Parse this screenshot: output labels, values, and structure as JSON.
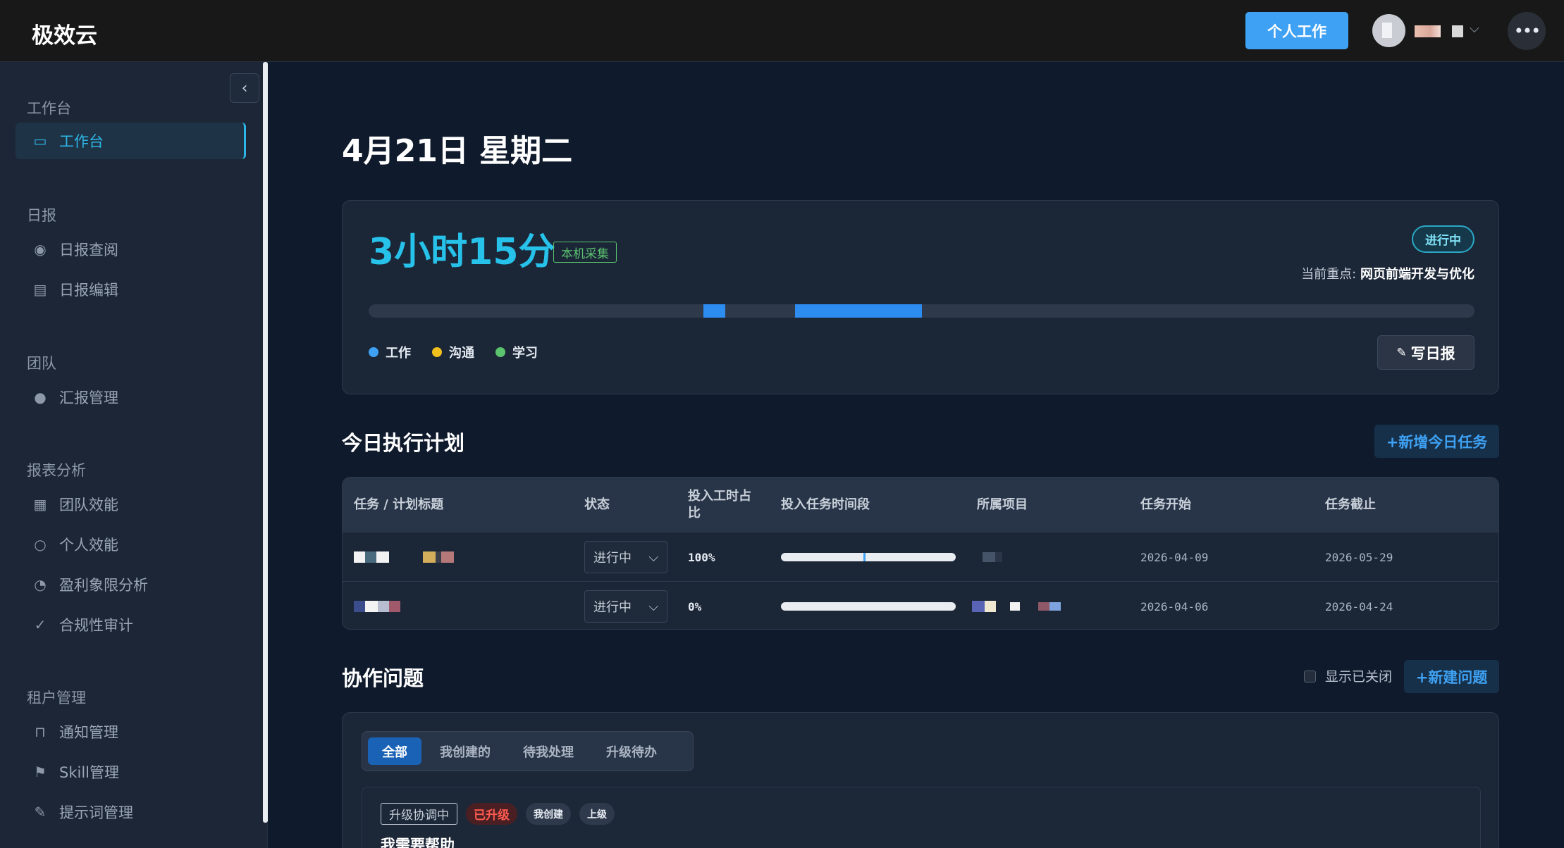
{
  "topbar": {
    "brand": "极效云",
    "personal_button": "个人工作",
    "more_icon": "more-horizontal-icon"
  },
  "sidebar": {
    "groups": [
      {
        "title": "工作台",
        "items": [
          {
            "label": "工作台",
            "icon": "monitor-icon",
            "active": true
          }
        ]
      },
      {
        "title": "日报",
        "items": [
          {
            "label": "日报查阅",
            "icon": "eye-icon"
          },
          {
            "label": "日报编辑",
            "icon": "document-icon"
          }
        ]
      },
      {
        "title": "团队",
        "items": [
          {
            "label": "汇报管理",
            "icon": "user-icon"
          }
        ]
      },
      {
        "title": "报表分析",
        "items": [
          {
            "label": "团队效能",
            "icon": "chart-icon"
          },
          {
            "label": "个人效能",
            "icon": "person-outline-icon"
          },
          {
            "label": "盈利象限分析",
            "icon": "pie-icon"
          },
          {
            "label": "合规性审计",
            "icon": "check-circle-icon"
          }
        ]
      },
      {
        "title": "租户管理",
        "items": [
          {
            "label": "通知管理",
            "icon": "board-icon"
          },
          {
            "label": "Skill管理",
            "icon": "flag-icon"
          },
          {
            "label": "提示词管理",
            "icon": "edit-icon"
          }
        ]
      }
    ]
  },
  "main": {
    "date_title": "4月21日 星期二",
    "time_card": {
      "total_time": "3小时15分",
      "source_tag": "本机采集",
      "status": "进行中",
      "focus_label": "当前重点:",
      "focus_value": "网页前端开发与优化",
      "legend": [
        {
          "label": "工作",
          "color": "#3ea1f3"
        },
        {
          "label": "沟通",
          "color": "#f2c01e"
        },
        {
          "label": "学习",
          "color": "#5cc46f"
        }
      ],
      "write_button": "写日报"
    },
    "plan": {
      "title": "今日执行计划",
      "add_button": "+新增今日任务",
      "columns": [
        "任务 / 计划标题",
        "状态",
        "投入工时占比",
        "投入任务时间段",
        "所属项目",
        "任务开始",
        "任务截止"
      ],
      "rows": [
        {
          "status": "进行中",
          "percent": "100%",
          "start": "2026-04-09",
          "end": "2026-05-29"
        },
        {
          "status": "进行中",
          "percent": "0%",
          "start": "2026-04-06",
          "end": "2026-04-24"
        }
      ]
    },
    "issues": {
      "title": "协作问题",
      "show_closed": "显示已关闭",
      "new_button": "+新建问题",
      "tabs": [
        "全部",
        "我创建的",
        "待我处理",
        "升级待办"
      ],
      "item": {
        "badges": [
          "升级协调中",
          "已升级",
          "我创建",
          "上级"
        ],
        "title": "我需要帮助"
      }
    }
  }
}
